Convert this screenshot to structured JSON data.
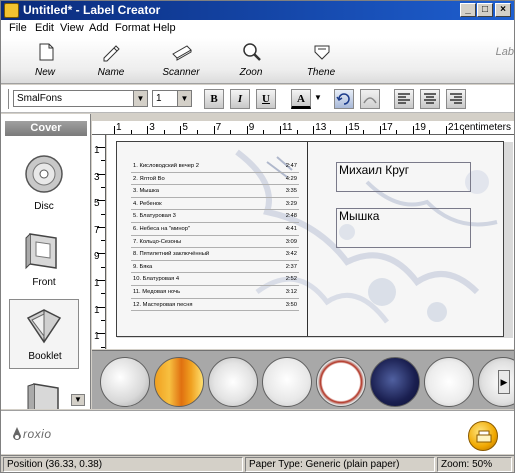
{
  "window": {
    "title": "Untitled* - Label Creator"
  },
  "menu": [
    "File",
    "Edit",
    "View",
    "Add",
    "Format",
    "Help"
  ],
  "toolbar": {
    "buttons": [
      {
        "label": "New",
        "icon": "new-document-icon"
      },
      {
        "label": "Name",
        "icon": "rename-pencil-icon"
      },
      {
        "label": "Scanner",
        "icon": "scanner-icon"
      },
      {
        "label": "Zoon",
        "icon": "zoom-magnifier-icon"
      },
      {
        "label": "Thene",
        "icon": "theme-icon"
      }
    ],
    "brand_text": "Lab"
  },
  "format_bar": {
    "font_value": "SmalFons",
    "size_value": "1",
    "bold": "B",
    "italic": "I",
    "underline": "U",
    "color": "A"
  },
  "left_panel": {
    "tab": "Cover",
    "items": [
      {
        "label": "Disc",
        "icon": "disc-icon"
      },
      {
        "label": "Front",
        "icon": "front-cover-icon"
      },
      {
        "label": "Booklet",
        "icon": "booklet-icon"
      },
      {
        "label": "",
        "icon": "back-cover-icon"
      }
    ]
  },
  "ruler": {
    "h_numbers": [
      "1",
      "3",
      "5",
      "7",
      "9",
      "11",
      "13",
      "15",
      "17",
      "19",
      "21"
    ],
    "unit": "centimeters",
    "v_numbers": [
      "1",
      "3",
      "5",
      "7",
      "9",
      "1",
      "1",
      "1"
    ]
  },
  "label": {
    "tracks": [
      {
        "title": "1. Кисловодский вечер 2",
        "time": "2:47"
      },
      {
        "title": "2. Ялтой Во",
        "time": "4:29"
      },
      {
        "title": "3. Мышка",
        "time": "3:35"
      },
      {
        "title": "4. Ребенок",
        "time": "3:29"
      },
      {
        "title": "5. Блатуровая 3",
        "time": "2:48"
      },
      {
        "title": "6. Небеса на \"минор\"",
        "time": "4:41"
      },
      {
        "title": "7. Кольцо-Сезоны",
        "time": "3:09"
      },
      {
        "title": "8. Пятилетний заключённый",
        "time": "3:42"
      },
      {
        "title": "9. Бяка",
        "time": "2:37"
      },
      {
        "title": "10. Блатуровая 4",
        "time": "2:52"
      },
      {
        "title": "11. Медовая ночь",
        "time": "3:12"
      },
      {
        "title": "12. Мастеровая песня",
        "time": "3:50"
      }
    ],
    "artist": "Михаил Круг",
    "album": "Мышка"
  },
  "status": {
    "position": "Position  (36.33, 0.38)",
    "paper": "Paper Type:  Generic (plain paper)",
    "zoom": "Zoom: 50%"
  },
  "footer": {
    "logo": "roxio"
  },
  "colors": {
    "title_bar": "#1e5fd0",
    "print_button": "#f0a800"
  }
}
